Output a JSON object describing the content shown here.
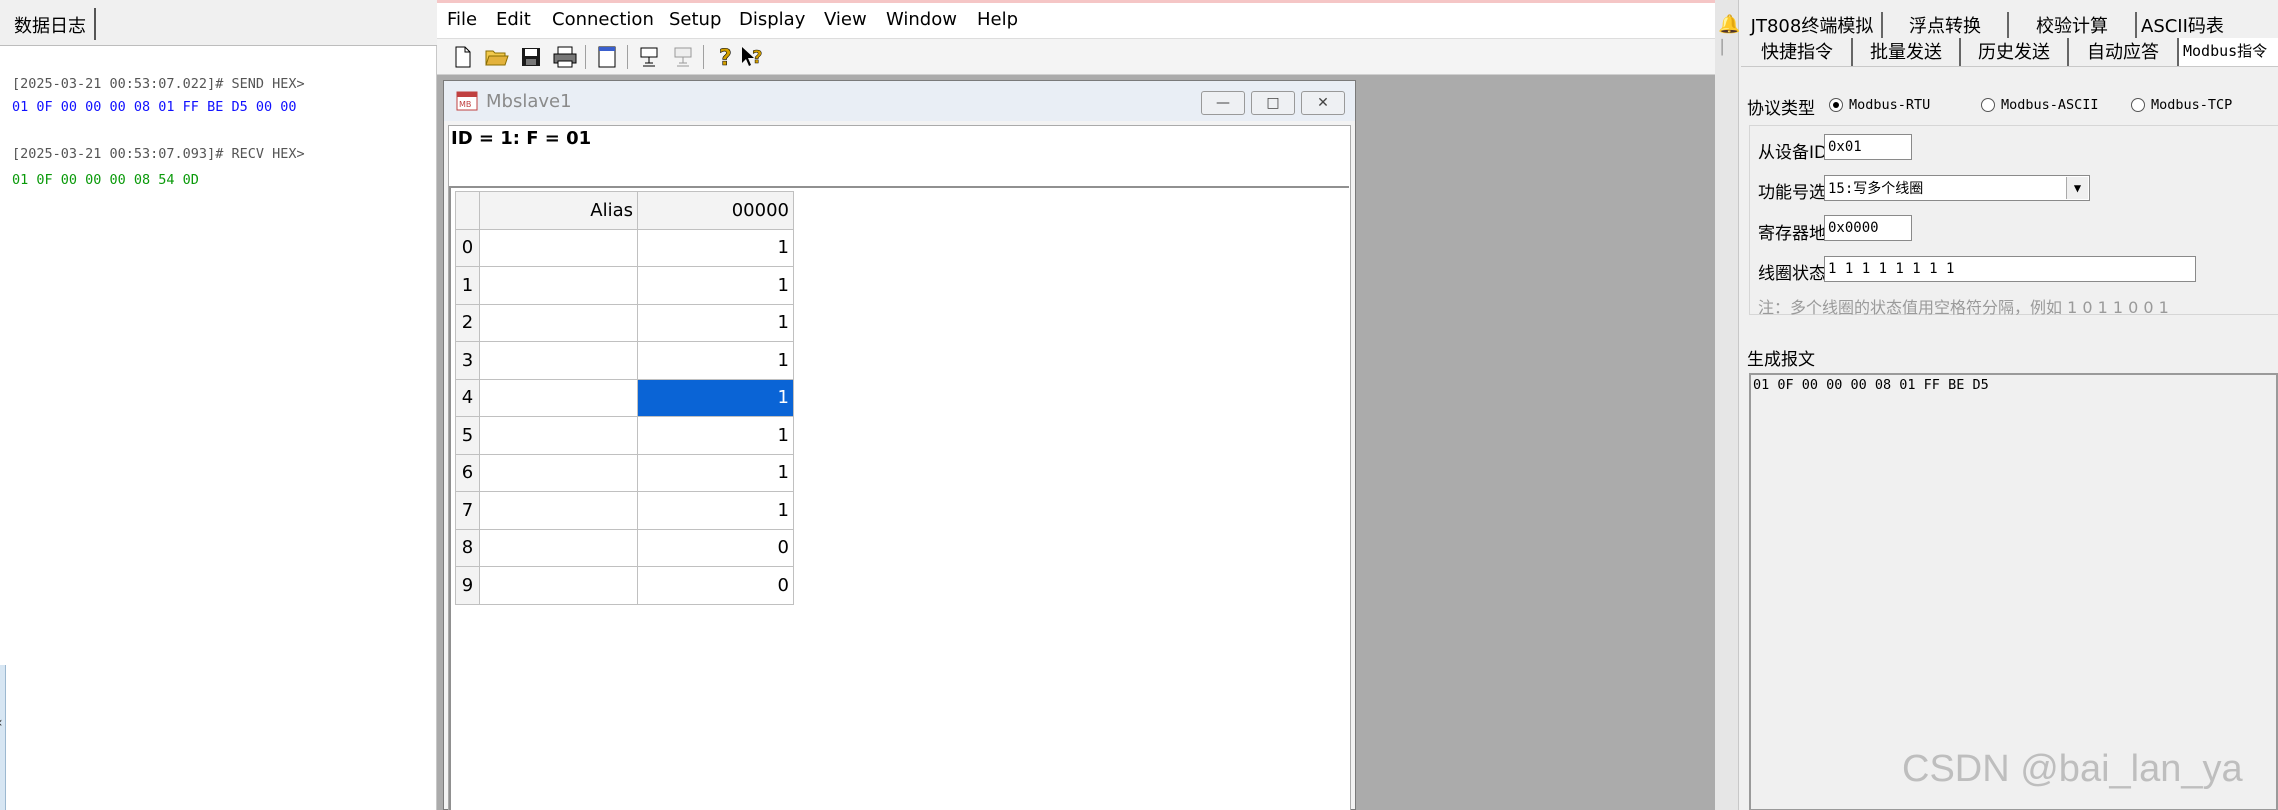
{
  "log_panel": {
    "tab_label": "数据日志",
    "entries": [
      {
        "header": "[2025-03-21 00:53:07.022]# SEND HEX>",
        "data": "01 0F 00 00 00 08 01 FF BE D5 00 00"
      },
      {
        "header": "[2025-03-21 00:53:07.093]# RECV HEX>",
        "data": "01 0F 00 00 00 08 54 0D"
      }
    ]
  },
  "menubar": [
    "File",
    "Edit",
    "Connection",
    "Setup",
    "Display",
    "View",
    "Window",
    "Help"
  ],
  "toolbar_icons": [
    "new-icon",
    "open-icon",
    "save-icon",
    "print-icon",
    "window-icon",
    "connect-icon",
    "disconnect-icon",
    "help-icon",
    "context-help-icon"
  ],
  "child_window": {
    "title": "Mbslave1",
    "status": "ID = 1: F = 01",
    "grid": {
      "alias_header": "Alias",
      "column_header": "00000",
      "rows": [
        {
          "index": "0",
          "value": "1"
        },
        {
          "index": "1",
          "value": "1"
        },
        {
          "index": "2",
          "value": "1"
        },
        {
          "index": "3",
          "value": "1"
        },
        {
          "index": "4",
          "value": "1"
        },
        {
          "index": "5",
          "value": "1"
        },
        {
          "index": "6",
          "value": "1"
        },
        {
          "index": "7",
          "value": "1"
        },
        {
          "index": "8",
          "value": "0"
        },
        {
          "index": "9",
          "value": "0"
        }
      ],
      "selected_row": 4
    }
  },
  "right_panel": {
    "tabs_row1": [
      "JT808终端模拟",
      "浮点转换",
      "校验计算",
      "ASCII码表"
    ],
    "tabs_row2": [
      "快捷指令",
      "批量发送",
      "历史发送",
      "自动应答",
      "Modbus指令"
    ],
    "protocol_label": "协议类型",
    "protocols": [
      "Modbus-RTU",
      "Modbus-ASCII",
      "Modbus-TCP"
    ],
    "protocol_selected": "Modbus-RTU",
    "slave_id_label": "从设备ID号",
    "slave_id_value": "0x01",
    "function_label": "功能号选择",
    "function_value": "15:写多个线圈",
    "register_label": "寄存器地址",
    "register_value": "0x0000",
    "coil_label": "线圈状态值",
    "coil_value": "1 1 1 1 1 1 1 1",
    "hint": "注：多个线圈的状态值用空格符分隔，例如 1 0 1 1 0 0 1",
    "generated_label": "生成报文",
    "generated_message": "01 0F 00 00 00 08 01 FF BE D5"
  },
  "watermark": "CSDN @bai_lan_ya",
  "colors": {
    "send": "#1010ff",
    "recv": "#0a9a0a",
    "selection": "#0a64d6"
  }
}
